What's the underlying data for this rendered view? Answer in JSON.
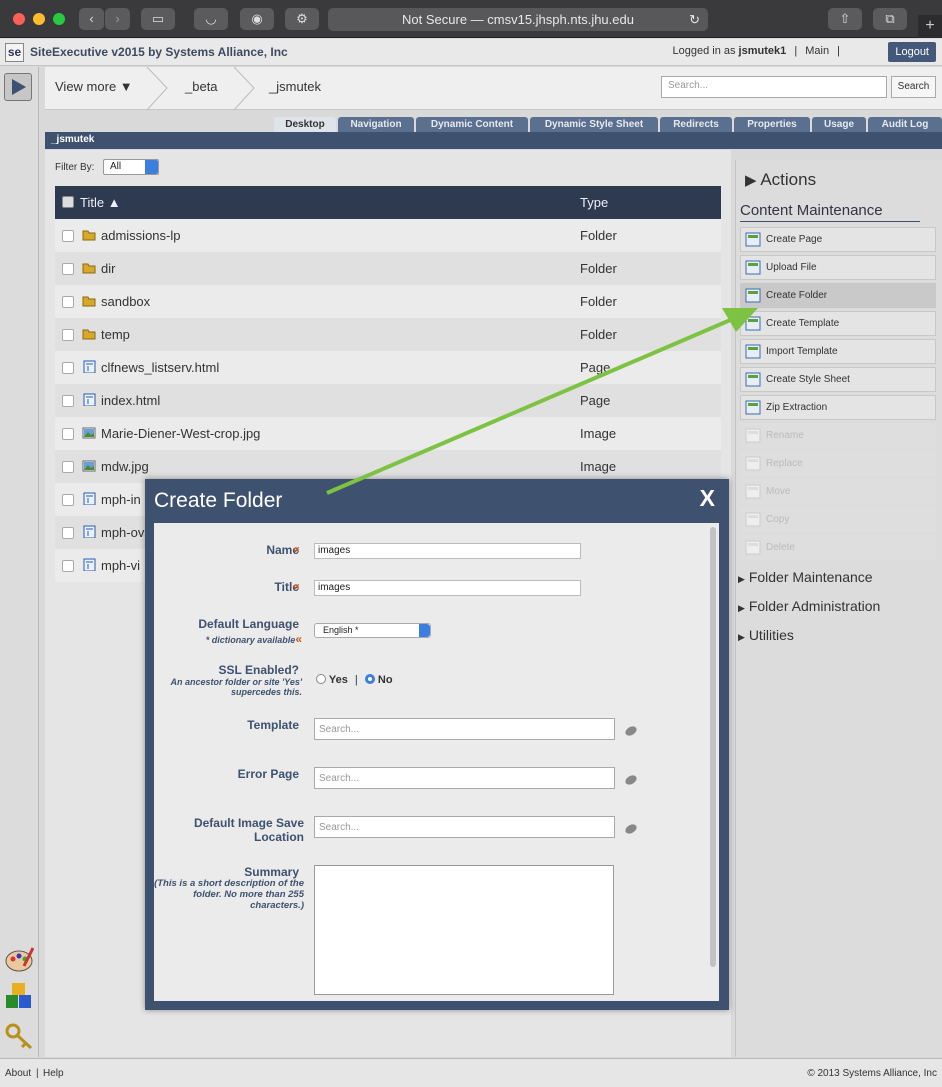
{
  "browser": {
    "url_text": "Not Secure — cmsv15.jhsph.nts.jhu.edu",
    "new_tab": "+"
  },
  "header": {
    "logo": "se",
    "app_name": "SiteExecutive v2015 by Systems Alliance, Inc",
    "logged_in_prefix": "Logged in as",
    "username": "jsmutek1",
    "main_link": "Main",
    "logout": "Logout"
  },
  "breadcrumb": {
    "view_more": "View more ▼",
    "items": [
      "_beta",
      "_jsmutek"
    ]
  },
  "search": {
    "placeholder": "Search...",
    "button": "Search"
  },
  "tabs": [
    "Desktop",
    "Navigation",
    "Dynamic Content",
    "Dynamic Style Sheet",
    "Redirects",
    "Properties",
    "Usage",
    "Audit Log"
  ],
  "path_label": "_jsmutek",
  "filter": {
    "label": "Filter By:",
    "value": "All"
  },
  "grid": {
    "columns": [
      "Title ▲",
      "Type"
    ],
    "rows": [
      {
        "title": "admissions-lp",
        "type": "Folder",
        "icon": "folder-icon"
      },
      {
        "title": "dir",
        "type": "Folder",
        "icon": "folder-icon"
      },
      {
        "title": "sandbox",
        "type": "Folder",
        "icon": "folder-icon"
      },
      {
        "title": "temp",
        "type": "Folder",
        "icon": "folder-icon"
      },
      {
        "title": "clfnews_listserv.html",
        "type": "Page",
        "icon": "page-icon"
      },
      {
        "title": "index.html",
        "type": "Page",
        "icon": "page-icon"
      },
      {
        "title": "Marie-Diener-West-crop.jpg",
        "type": "Image",
        "icon": "image-icon"
      },
      {
        "title": "mdw.jpg",
        "type": "Image",
        "icon": "image-icon"
      },
      {
        "title": "mph-in",
        "type": "",
        "icon": "page-icon"
      },
      {
        "title": "mph-ov",
        "type": "",
        "icon": "page-icon"
      },
      {
        "title": "mph-vi",
        "type": "",
        "icon": "page-icon"
      }
    ]
  },
  "actions": {
    "title": "Actions",
    "content_maintenance": "Content Maintenance",
    "items": [
      {
        "label": "Create Page",
        "enabled": true
      },
      {
        "label": "Upload File",
        "enabled": true
      },
      {
        "label": "Create Folder",
        "enabled": true
      },
      {
        "label": "Create Template",
        "enabled": true
      },
      {
        "label": "Import Template",
        "enabled": true
      },
      {
        "label": "Create Style Sheet",
        "enabled": true
      },
      {
        "label": "Zip Extraction",
        "enabled": true
      },
      {
        "label": "Rename",
        "enabled": false
      },
      {
        "label": "Replace",
        "enabled": false
      },
      {
        "label": "Move",
        "enabled": false
      },
      {
        "label": "Copy",
        "enabled": false
      },
      {
        "label": "Delete",
        "enabled": false
      }
    ],
    "sections": [
      "Folder Maintenance",
      "Folder Administration",
      "Utilities"
    ]
  },
  "dialog": {
    "title": "Create Folder",
    "close": "X",
    "required_mark": "«",
    "name_label": "Name",
    "name_value": "images",
    "title_label": "Title",
    "title_value": "images",
    "language_label": "Default Language",
    "language_sub": "* dictionary available",
    "language_value": "English *",
    "ssl_label": "SSL Enabled?",
    "ssl_sub": "An ancestor folder or site 'Yes' supercedes this.",
    "ssl_yes": "Yes",
    "ssl_sep": "|",
    "ssl_no": "No",
    "template_label": "Template",
    "error_page_label": "Error Page",
    "image_loc_label": "Default Image Save Location",
    "search_placeholder": "Search...",
    "summary_label": "Summary",
    "summary_sub": "(This is a short description of the folder. No more than 255 characters.)"
  },
  "footer": {
    "about": "About",
    "sep": "|",
    "help": "Help",
    "copyright": "© 2013 Systems Alliance, Inc"
  },
  "colors": {
    "navy": "#3e516f",
    "grid_header": "#2d3a50",
    "required": "#d05a1a",
    "annotation_arrow": "#7dc242"
  }
}
